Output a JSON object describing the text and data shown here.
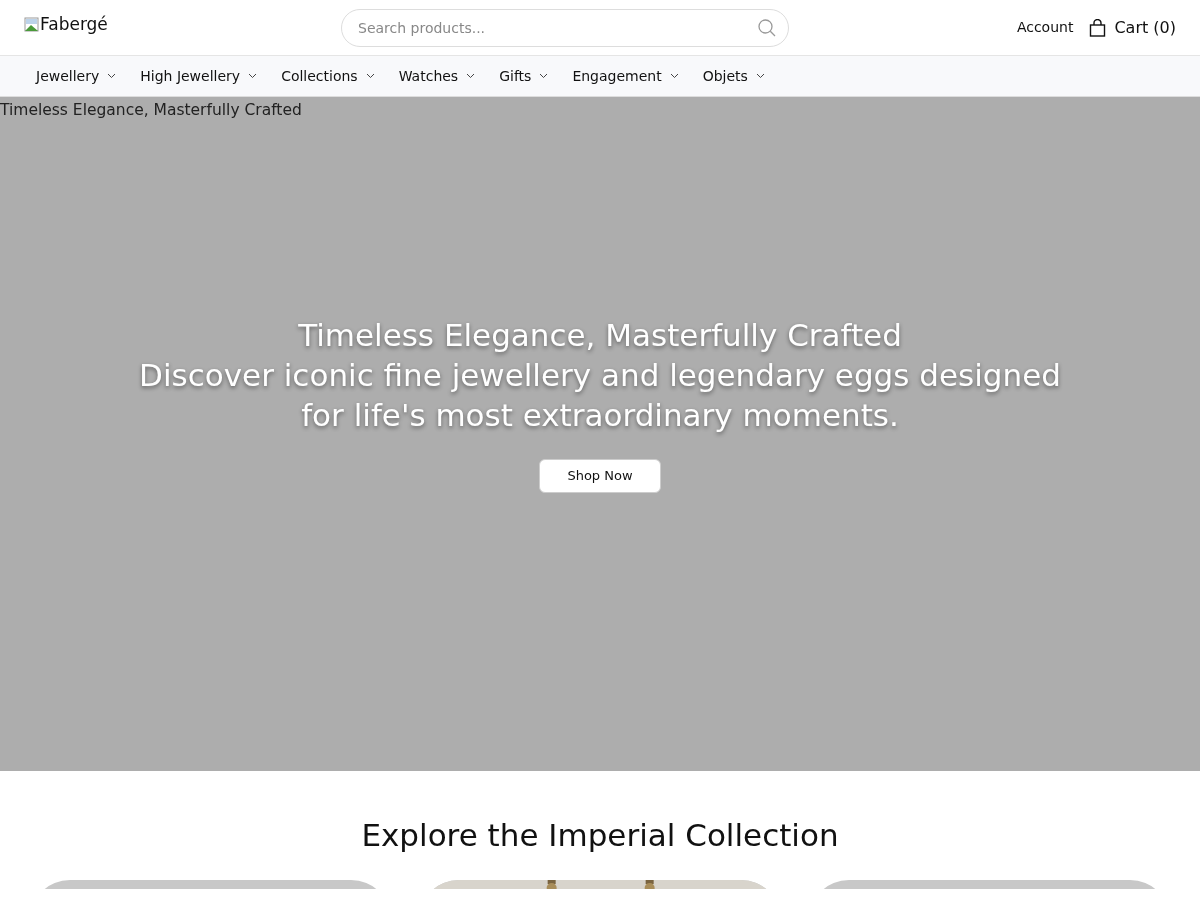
{
  "header": {
    "logo_alt": "Fabergé",
    "search": {
      "placeholder": "Search products..."
    },
    "account": "Account",
    "cart": "Cart (0)"
  },
  "nav": [
    {
      "label": "Jewellery"
    },
    {
      "label": "High Jewellery"
    },
    {
      "label": "Collections"
    },
    {
      "label": "Watches"
    },
    {
      "label": "Gifts"
    },
    {
      "label": "Engagement"
    },
    {
      "label": "Objets"
    }
  ],
  "hero": {
    "image_alt": "Timeless Elegance, Masterfully Crafted",
    "title": "Timeless Elegance, Masterfully Crafted",
    "subtitle": "Discover iconic fine jewellery and legendary eggs designed for life's most extraordinary moments.",
    "button": "Shop Now"
  },
  "section": {
    "title": "Explore the Imperial Collection",
    "cards": [
      {
        "kind": "placeholder"
      },
      {
        "kind": "picture"
      },
      {
        "kind": "placeholder"
      }
    ]
  }
}
